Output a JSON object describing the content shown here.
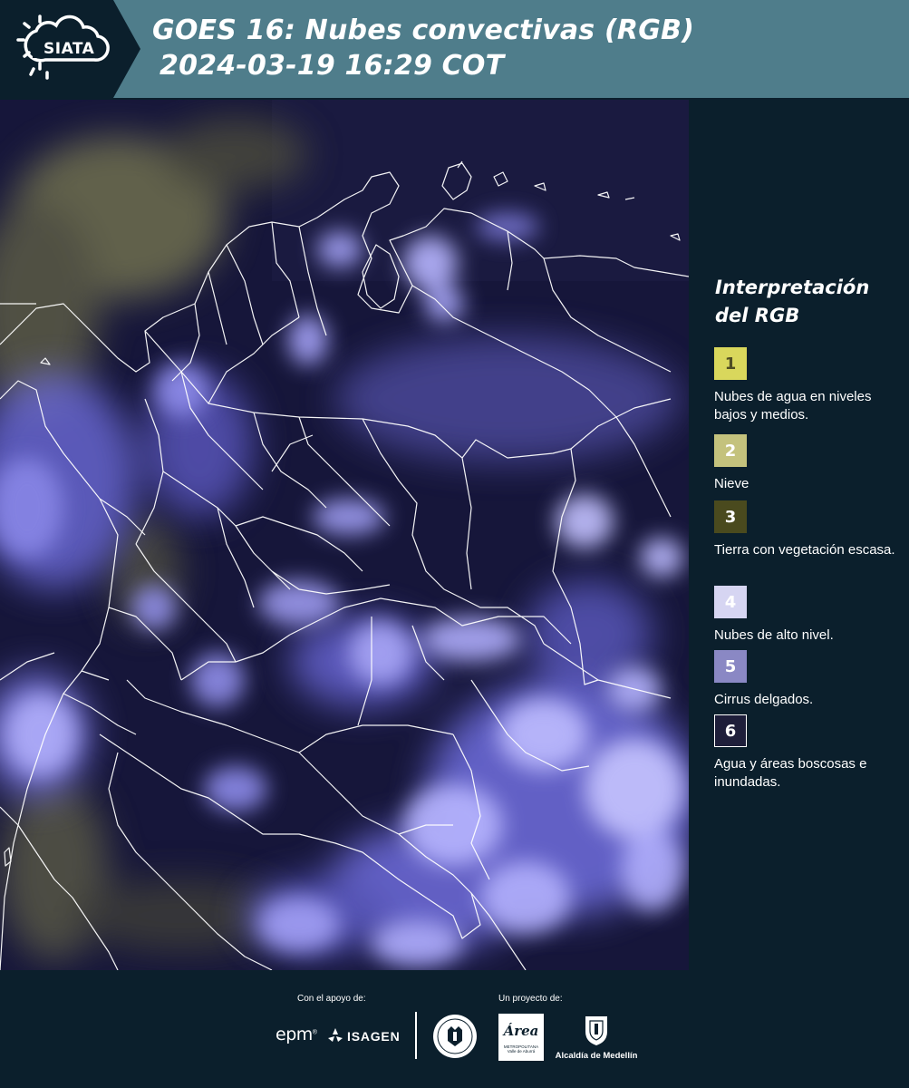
{
  "header": {
    "logo_text": "SIATA",
    "title_line1": "GOES 16: Nubes convectivas (RGB)",
    "title_line2": "2024-03-19 16:29 COT"
  },
  "legend": {
    "title_line1": "Interpretación",
    "title_line2": "del RGB",
    "items": [
      {
        "num": "1",
        "color": "#d9d75c",
        "num_color": "#4f4d24",
        "label": "Nubes de agua en niveles bajos y medios."
      },
      {
        "num": "2",
        "color": "#c4c27d",
        "num_color": "#ffffff",
        "label": "Nieve"
      },
      {
        "num": "3",
        "color": "#4a4a1e",
        "num_color": "#ffffff",
        "label": "Tierra con vegetación escasa."
      },
      {
        "num": "4",
        "color": "#d6d5f2",
        "num_color": "#ffffff",
        "label": "Nubes de alto nivel."
      },
      {
        "num": "5",
        "color": "#8a88c4",
        "num_color": "#ffffff",
        "label": "Cirrus delgados."
      },
      {
        "num": "6",
        "color": "#1e1e3a",
        "num_color": "#ffffff",
        "label": "Agua y áreas boscosas e inundadas."
      }
    ]
  },
  "footer": {
    "support_label": "Con el apoyo de:",
    "project_label": "Un proyecto de:",
    "epm": "epm",
    "isagen": "ISAGEN",
    "area_word": "Área",
    "area_sub1": "METROPOLITANA",
    "area_sub2": "Valle de Aburrá",
    "alcaldia": "Alcaldía de Medellín"
  },
  "colors": {
    "header_bg": "#4f7d8b",
    "logo_bg": "#0b1f2c",
    "page_bg": "#0b1f2c",
    "cloud_high": "#8a86f0",
    "cloud_low": "#b8b56a",
    "ground_dark": "#16163a",
    "border_lines": "#ffffff"
  }
}
